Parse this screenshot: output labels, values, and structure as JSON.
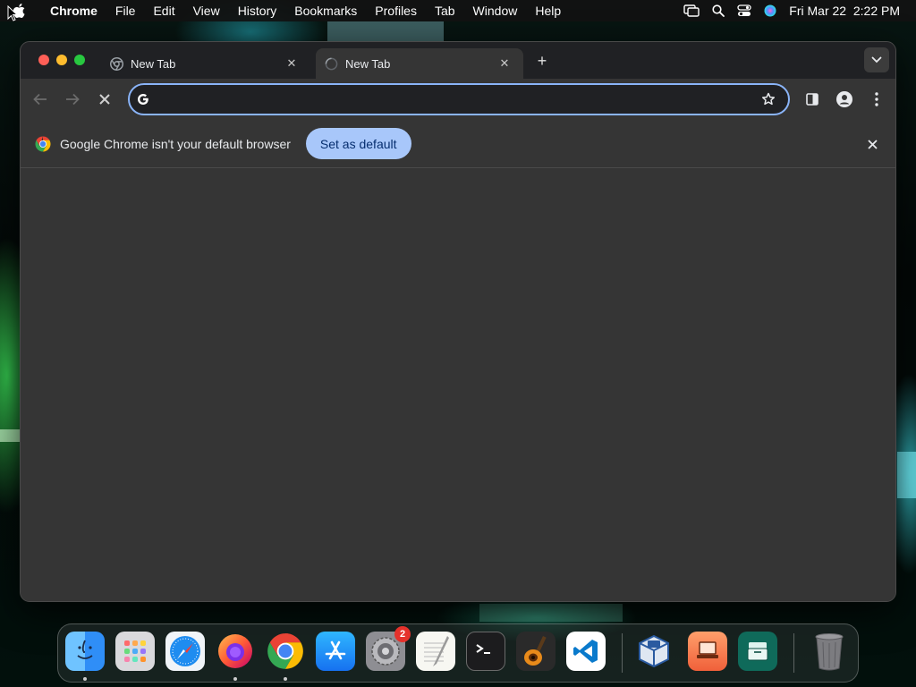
{
  "menubar": {
    "app_name": "Chrome",
    "items": [
      "File",
      "Edit",
      "View",
      "History",
      "Bookmarks",
      "Profiles",
      "Tab",
      "Window",
      "Help"
    ],
    "clock": "Fri Mar 22  2:22 PM"
  },
  "browser": {
    "tabs": [
      {
        "title": "New Tab",
        "icon": "chrome-icon",
        "active": false
      },
      {
        "title": "New Tab",
        "icon": "loading-spinner-icon",
        "active": true
      }
    ],
    "omnibox": {
      "value": "",
      "placeholder": ""
    },
    "infobar": {
      "message": "Google Chrome isn't your default browser",
      "button_label": "Set as default"
    },
    "colors": {
      "accent": "#8ab4f8",
      "button_bg": "#a8c7fa",
      "page_bg": "#353535",
      "tabstrip_bg": "#202124"
    }
  },
  "dock": {
    "items": [
      {
        "name": "Finder",
        "icon": "finder-icon",
        "running": true
      },
      {
        "name": "Launchpad",
        "icon": "launchpad-icon",
        "running": false
      },
      {
        "name": "Safari",
        "icon": "safari-icon",
        "running": false
      },
      {
        "name": "Firefox",
        "icon": "firefox-icon",
        "running": true
      },
      {
        "name": "Google Chrome",
        "icon": "chrome-icon",
        "running": true
      },
      {
        "name": "App Store",
        "icon": "app-store-icon",
        "running": false
      },
      {
        "name": "System Settings",
        "icon": "settings-icon",
        "running": false,
        "badge": "2"
      },
      {
        "name": "TextEdit",
        "icon": "textedit-icon",
        "running": false
      },
      {
        "name": "Terminal",
        "icon": "terminal-icon",
        "running": false
      },
      {
        "name": "GarageBand",
        "icon": "garageband-icon",
        "running": false
      },
      {
        "name": "Visual Studio Code",
        "icon": "vscode-icon",
        "running": false
      },
      {
        "name": "VirtualBox",
        "icon": "virtualbox-icon",
        "running": false
      },
      {
        "name": "Laptop App",
        "icon": "laptop-app-icon",
        "running": false
      },
      {
        "name": "Storage App",
        "icon": "storage-app-icon",
        "running": false
      },
      {
        "name": "Trash",
        "icon": "trash-icon",
        "running": false
      }
    ]
  }
}
